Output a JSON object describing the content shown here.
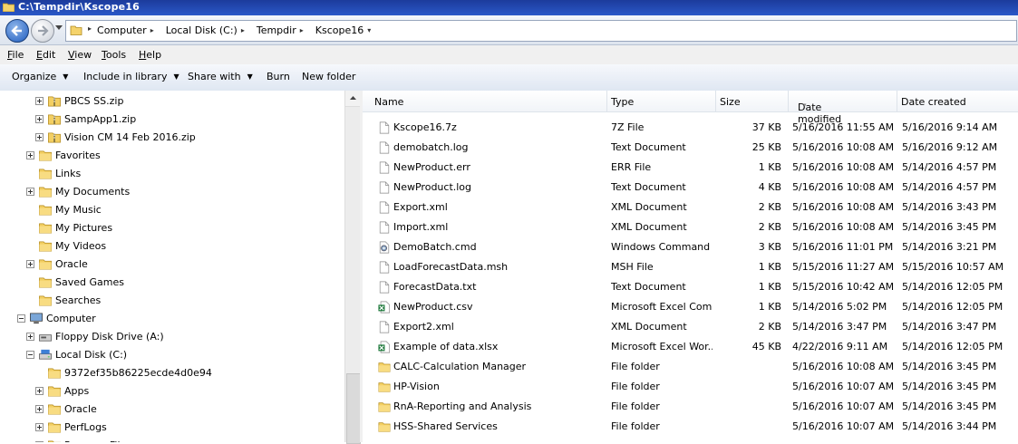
{
  "window": {
    "title": "C:\\Tempdir\\Kscope16"
  },
  "address": {
    "crumbs": [
      "Computer",
      "Local Disk (C:)",
      "Tempdir",
      "Kscope16"
    ]
  },
  "menu": [
    {
      "label": "File",
      "key": "F",
      "rest": "ile"
    },
    {
      "label": "Edit",
      "key": "E",
      "rest": "dit"
    },
    {
      "label": "View",
      "key": "V",
      "rest": "iew"
    },
    {
      "label": "Tools",
      "key": "T",
      "rest": "ools"
    },
    {
      "label": "Help",
      "key": "H",
      "rest": "elp"
    }
  ],
  "commands": {
    "organize": "Organize",
    "include": "Include in library",
    "share": "Share with",
    "burn": "Burn",
    "new_folder": "New folder"
  },
  "tree": [
    {
      "label": "PBCS SS.zip",
      "icon": "zip-icon",
      "expander": "plus"
    },
    {
      "label": "SampApp1.zip",
      "icon": "zip-icon",
      "expander": "plus"
    },
    {
      "label": "Vision CM 14 Feb 2016.zip",
      "icon": "zip-icon",
      "expander": "plus"
    },
    {
      "label": "Favorites",
      "icon": "folder-icon",
      "expander": "plus"
    },
    {
      "label": "Links",
      "icon": "folder-icon",
      "expander": "none"
    },
    {
      "label": "My Documents",
      "icon": "folder-icon",
      "expander": "plus"
    },
    {
      "label": "My Music",
      "icon": "folder-icon",
      "expander": "none"
    },
    {
      "label": "My Pictures",
      "icon": "folder-icon",
      "expander": "none"
    },
    {
      "label": "My Videos",
      "icon": "folder-icon",
      "expander": "none"
    },
    {
      "label": "Oracle",
      "icon": "folder-icon",
      "expander": "plus"
    },
    {
      "label": "Saved Games",
      "icon": "folder-icon",
      "expander": "none"
    },
    {
      "label": "Searches",
      "icon": "folder-icon",
      "expander": "none"
    },
    {
      "label": "Computer",
      "icon": "computer-icon",
      "expander": "minus"
    },
    {
      "label": "Floppy Disk Drive (A:)",
      "icon": "floppy-icon",
      "expander": "plus"
    },
    {
      "label": "Local Disk (C:)",
      "icon": "disk-icon",
      "expander": "minus"
    },
    {
      "label": "9372ef35b86225ecde4d0e94",
      "icon": "folder-icon",
      "expander": "none"
    },
    {
      "label": "Apps",
      "icon": "folder-icon",
      "expander": "plus"
    },
    {
      "label": "Oracle",
      "icon": "folder-icon",
      "expander": "plus"
    },
    {
      "label": "PerfLogs",
      "icon": "folder-icon",
      "expander": "plus"
    },
    {
      "label": "Program Files",
      "icon": "folder-icon",
      "expander": "plus"
    }
  ],
  "columns": {
    "name": "Name",
    "type": "Type",
    "size": "Size",
    "modified": "Date modified",
    "created": "Date created"
  },
  "files": [
    {
      "name": "Kscope16.7z",
      "type": "7Z File",
      "size": "37 KB",
      "modified": "5/16/2016 11:55 AM",
      "created": "5/16/2016 9:14 AM",
      "icon": "file-icon"
    },
    {
      "name": "demobatch.log",
      "type": "Text Document",
      "size": "25 KB",
      "modified": "5/16/2016 10:08 AM",
      "created": "5/16/2016 9:12 AM",
      "icon": "file-icon"
    },
    {
      "name": "NewProduct.err",
      "type": "ERR File",
      "size": "1 KB",
      "modified": "5/16/2016 10:08 AM",
      "created": "5/14/2016 4:57 PM",
      "icon": "file-icon"
    },
    {
      "name": "NewProduct.log",
      "type": "Text Document",
      "size": "4 KB",
      "modified": "5/16/2016 10:08 AM",
      "created": "5/14/2016 4:57 PM",
      "icon": "file-icon"
    },
    {
      "name": "Export.xml",
      "type": "XML Document",
      "size": "2 KB",
      "modified": "5/16/2016 10:08 AM",
      "created": "5/14/2016 3:43 PM",
      "icon": "file-icon"
    },
    {
      "name": "Import.xml",
      "type": "XML Document",
      "size": "2 KB",
      "modified": "5/16/2016 10:08 AM",
      "created": "5/14/2016 3:45 PM",
      "icon": "file-icon"
    },
    {
      "name": "DemoBatch.cmd",
      "type": "Windows Command ...",
      "size": "3 KB",
      "modified": "5/16/2016 11:01 PM",
      "created": "5/14/2016 3:21 PM",
      "icon": "cmd-icon"
    },
    {
      "name": "LoadForecastData.msh",
      "type": "MSH File",
      "size": "1 KB",
      "modified": "5/15/2016 11:27 AM",
      "created": "5/15/2016 10:57 AM",
      "icon": "file-icon"
    },
    {
      "name": "ForecastData.txt",
      "type": "Text Document",
      "size": "1 KB",
      "modified": "5/15/2016 10:42 AM",
      "created": "5/14/2016 12:05 PM",
      "icon": "file-icon"
    },
    {
      "name": "NewProduct.csv",
      "type": "Microsoft Excel Com...",
      "size": "1 KB",
      "modified": "5/14/2016 5:02 PM",
      "created": "5/14/2016 12:05 PM",
      "icon": "excel-icon"
    },
    {
      "name": "Export2.xml",
      "type": "XML Document",
      "size": "2 KB",
      "modified": "5/14/2016 3:47 PM",
      "created": "5/14/2016 3:47 PM",
      "icon": "file-icon"
    },
    {
      "name": "Example of data.xlsx",
      "type": "Microsoft Excel Wor...",
      "size": "45 KB",
      "modified": "4/22/2016 9:11 AM",
      "created": "5/14/2016 12:05 PM",
      "icon": "excel-icon"
    },
    {
      "name": "CALC-Calculation Manager",
      "type": "File folder",
      "size": "",
      "modified": "5/16/2016 10:08 AM",
      "created": "5/14/2016 3:45 PM",
      "icon": "folder-icon"
    },
    {
      "name": "HP-Vision",
      "type": "File folder",
      "size": "",
      "modified": "5/16/2016 10:07 AM",
      "created": "5/14/2016 3:45 PM",
      "icon": "folder-icon"
    },
    {
      "name": "RnA-Reporting and Analysis",
      "type": "File folder",
      "size": "",
      "modified": "5/16/2016 10:07 AM",
      "created": "5/14/2016 3:45 PM",
      "icon": "folder-icon"
    },
    {
      "name": "HSS-Shared Services",
      "type": "File folder",
      "size": "",
      "modified": "5/16/2016 10:07 AM",
      "created": "5/14/2016 3:44 PM",
      "icon": "folder-icon"
    }
  ]
}
